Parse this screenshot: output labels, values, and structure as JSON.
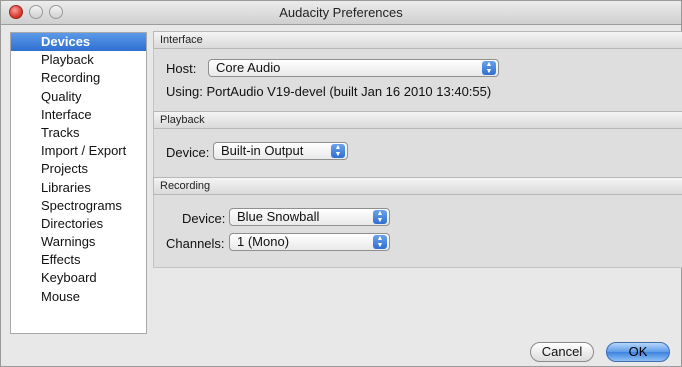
{
  "window": {
    "title": "Audacity Preferences"
  },
  "sidebar": {
    "items": [
      {
        "label": "Devices",
        "selected": true
      },
      {
        "label": "Playback"
      },
      {
        "label": "Recording"
      },
      {
        "label": "Quality"
      },
      {
        "label": "Interface"
      },
      {
        "label": "Tracks"
      },
      {
        "label": "Import / Export"
      },
      {
        "label": "Projects"
      },
      {
        "label": "Libraries"
      },
      {
        "label": "Spectrograms"
      },
      {
        "label": "Directories"
      },
      {
        "label": "Warnings"
      },
      {
        "label": "Effects"
      },
      {
        "label": "Keyboard"
      },
      {
        "label": "Mouse"
      }
    ]
  },
  "interface": {
    "header": "Interface",
    "host_label": "Host:",
    "host_value": "Core Audio",
    "using_text": "Using: PortAudio V19-devel (built Jan 16 2010 13:40:55)"
  },
  "playback": {
    "header": "Playback",
    "device_label": "Device:",
    "device_value": "Built-in Output"
  },
  "recording": {
    "header": "Recording",
    "device_label": "Device:",
    "device_value": "Blue Snowball",
    "channels_label": "Channels:",
    "channels_value": "1 (Mono)"
  },
  "buttons": {
    "cancel": "Cancel",
    "ok": "OK"
  },
  "icons": {
    "close": "close-icon",
    "minimize": "minimize-icon",
    "zoom": "zoom-icon",
    "popup_arrows": "up-down-arrows-icon"
  }
}
